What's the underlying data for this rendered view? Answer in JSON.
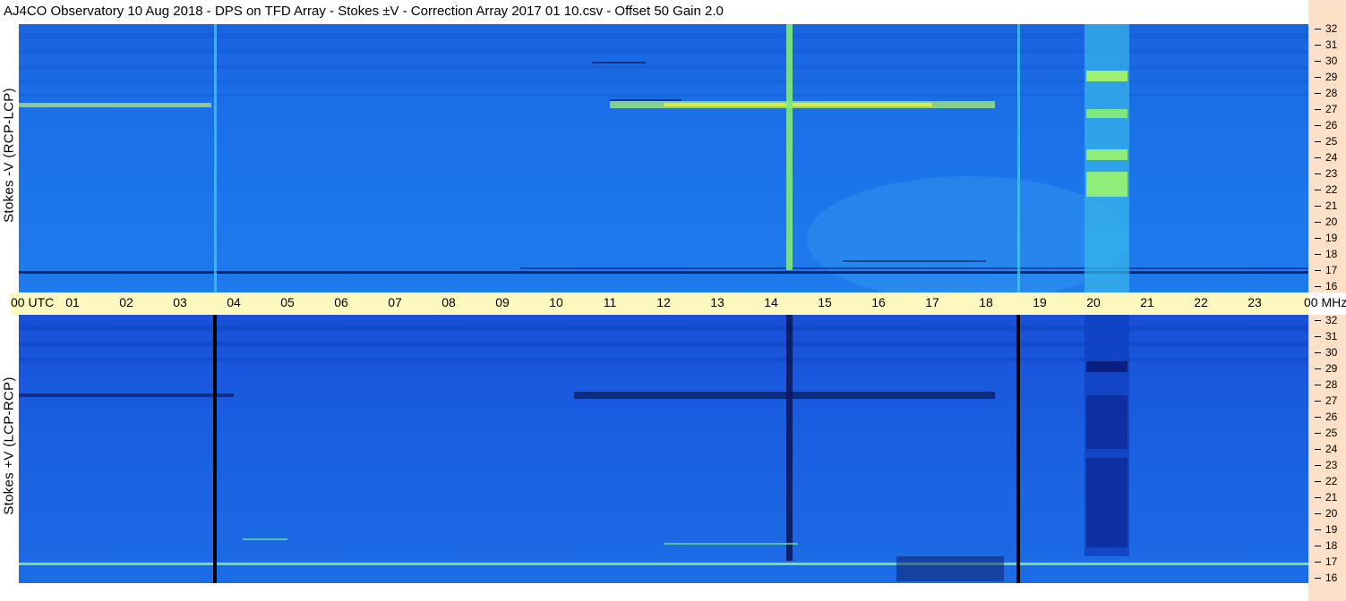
{
  "title": "AJ4CO Observatory  10 Aug 2018  -  DPS on TFD Array  -  Stokes ±V  -  Correction Array 2017 01 10.csv  -  Offset 50  Gain 2.0",
  "panels": [
    {
      "ylabel": "Stokes -V (RCP-LCP)"
    },
    {
      "ylabel": "Stokes +V (LCP-RCP)"
    }
  ],
  "time_axis": {
    "labels": [
      "00 UTC",
      "01",
      "02",
      "03",
      "04",
      "05",
      "06",
      "07",
      "08",
      "09",
      "10",
      "11",
      "12",
      "13",
      "14",
      "15",
      "16",
      "17",
      "18",
      "19",
      "20",
      "21",
      "22",
      "23",
      "00 MHz"
    ]
  },
  "freq_axis": {
    "labels": [
      "32",
      "31",
      "30",
      "29",
      "28",
      "27",
      "26",
      "25",
      "24",
      "23",
      "22",
      "21",
      "20",
      "19",
      "18",
      "17",
      "16"
    ]
  },
  "colors": {
    "background_blue": "#1c72e8",
    "time_band": "#fdf8be",
    "freq_strip": "#fde0c8",
    "bright": "#b0f060",
    "dark": "#0a1a60"
  },
  "chart_data": {
    "type": "heatmap",
    "title": "AJ4CO Observatory  10 Aug 2018  -  DPS on TFD Array  -  Stokes ±V  -  Correction Array 2017 01 10.csv  -  Offset 50  Gain 2.0",
    "x_unit": "UTC hours",
    "x_range": [
      0,
      24
    ],
    "y_unit": "MHz",
    "y_range": [
      16,
      32
    ],
    "panels": [
      {
        "ylabel": "Stokes -V (RCP-LCP)"
      },
      {
        "ylabel": "Stokes +V (LCP-RCP)"
      }
    ]
  }
}
